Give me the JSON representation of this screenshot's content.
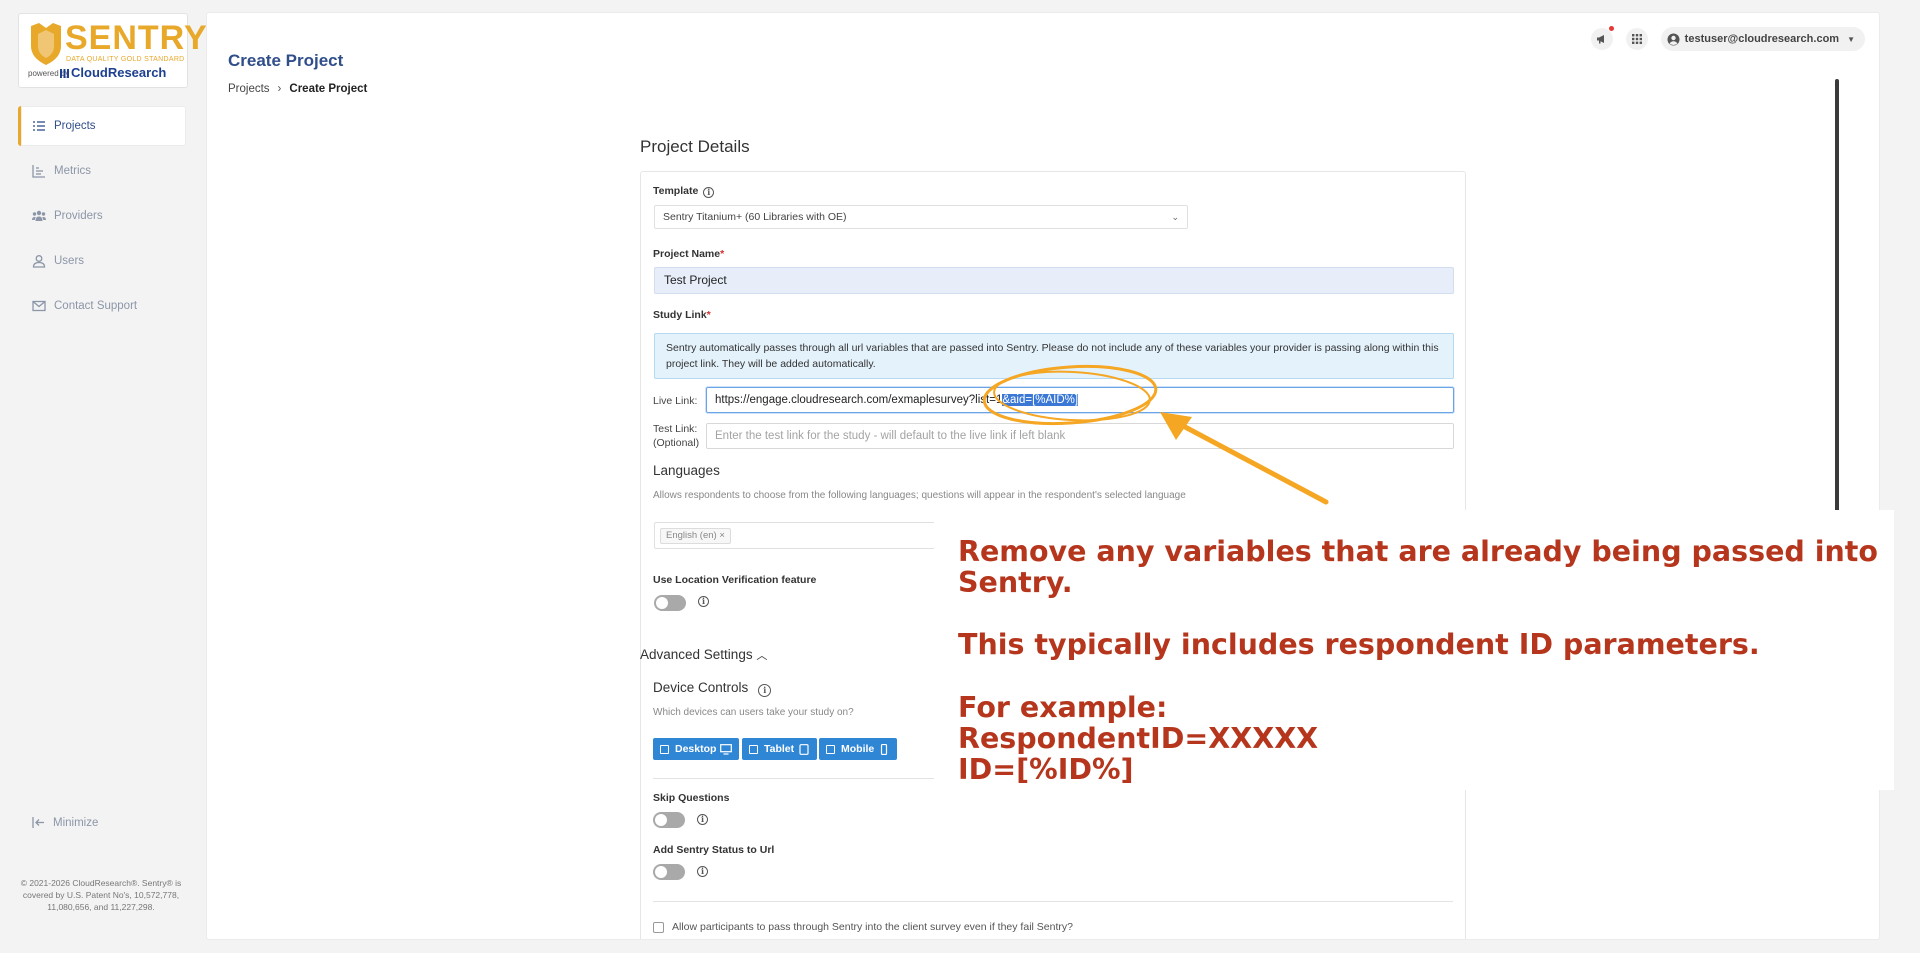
{
  "brand": {
    "wordmark": "SENTRY",
    "tagline": "DATA QUALITY GOLD STANDARD",
    "powered_by": "powered by",
    "partner": "CloudResearch",
    "accent": "#e8a82a"
  },
  "sidebar": {
    "items": [
      {
        "label": "Projects",
        "icon": "list-icon",
        "active": true
      },
      {
        "label": "Metrics",
        "icon": "bar-chart-icon",
        "active": false
      },
      {
        "label": "Providers",
        "icon": "users-group-icon",
        "active": false
      },
      {
        "label": "Users",
        "icon": "user-icon",
        "active": false
      },
      {
        "label": "Contact Support",
        "icon": "mail-icon",
        "active": false
      }
    ],
    "minimize_label": "Minimize",
    "copyright": "© 2021-2026 CloudResearch®. Sentry® is covered by U.S. Patent No's, 10,572,778, 11,080,656, and 11,227,298."
  },
  "header": {
    "title": "Create Project",
    "breadcrumb": [
      "Projects",
      "Create Project"
    ],
    "user_email": "testuser@cloudresearch.com"
  },
  "form": {
    "section_title": "Project Details",
    "template_label": "Template",
    "template_value": "Sentry Titanium+ (60 Libraries with OE)",
    "project_name_label": "Project Name",
    "project_name_value": "Test Project",
    "study_link_label": "Study Link",
    "study_link_alert": "Sentry automatically passes through all url variables that are passed into Sentry. Please do not include any of these variables your provider is passing along within this project link. They will be added automatically.",
    "live_link_label": "Live Link:",
    "live_link_value_plain": "https://engage.cloudresearch.com/exmaplesurvey?list=1",
    "live_link_value_selected": "&aid=[%AID%]",
    "test_link_label": "Test Link: (Optional)",
    "test_link_placeholder": "Enter the test link for the study - will default to the live link if left blank",
    "languages_title": "Languages",
    "languages_hint": "Allows respondents to choose from the following languages; questions will appear in the respondent's selected language",
    "language_tag": "English (en) ×",
    "location_label": "Use Location Verification feature",
    "location_enabled": false,
    "advanced_title": "Advanced Settings",
    "device_controls_title": "Device Controls",
    "device_controls_hint": "Which devices can users take your study on?",
    "devices": [
      "Desktop",
      "Tablet",
      "Mobile"
    ],
    "skip_questions_label": "Skip Questions",
    "skip_questions_enabled": false,
    "add_status_label": "Add Sentry Status to Url",
    "add_status_enabled": false,
    "footer_checkbox_label": "Allow participants to pass through Sentry into the client survey even if they fail Sentry?"
  },
  "annotation": {
    "line1": "Remove any variables that are already being passed into",
    "line2": "Sentry.",
    "line3": "This typically includes respondent ID parameters.",
    "line4": "For example:",
    "line5": "RespondentID=XXXXX",
    "line6": "ID=[%ID%]",
    "color": "#b5361c",
    "marker_color": "#f5a623"
  }
}
